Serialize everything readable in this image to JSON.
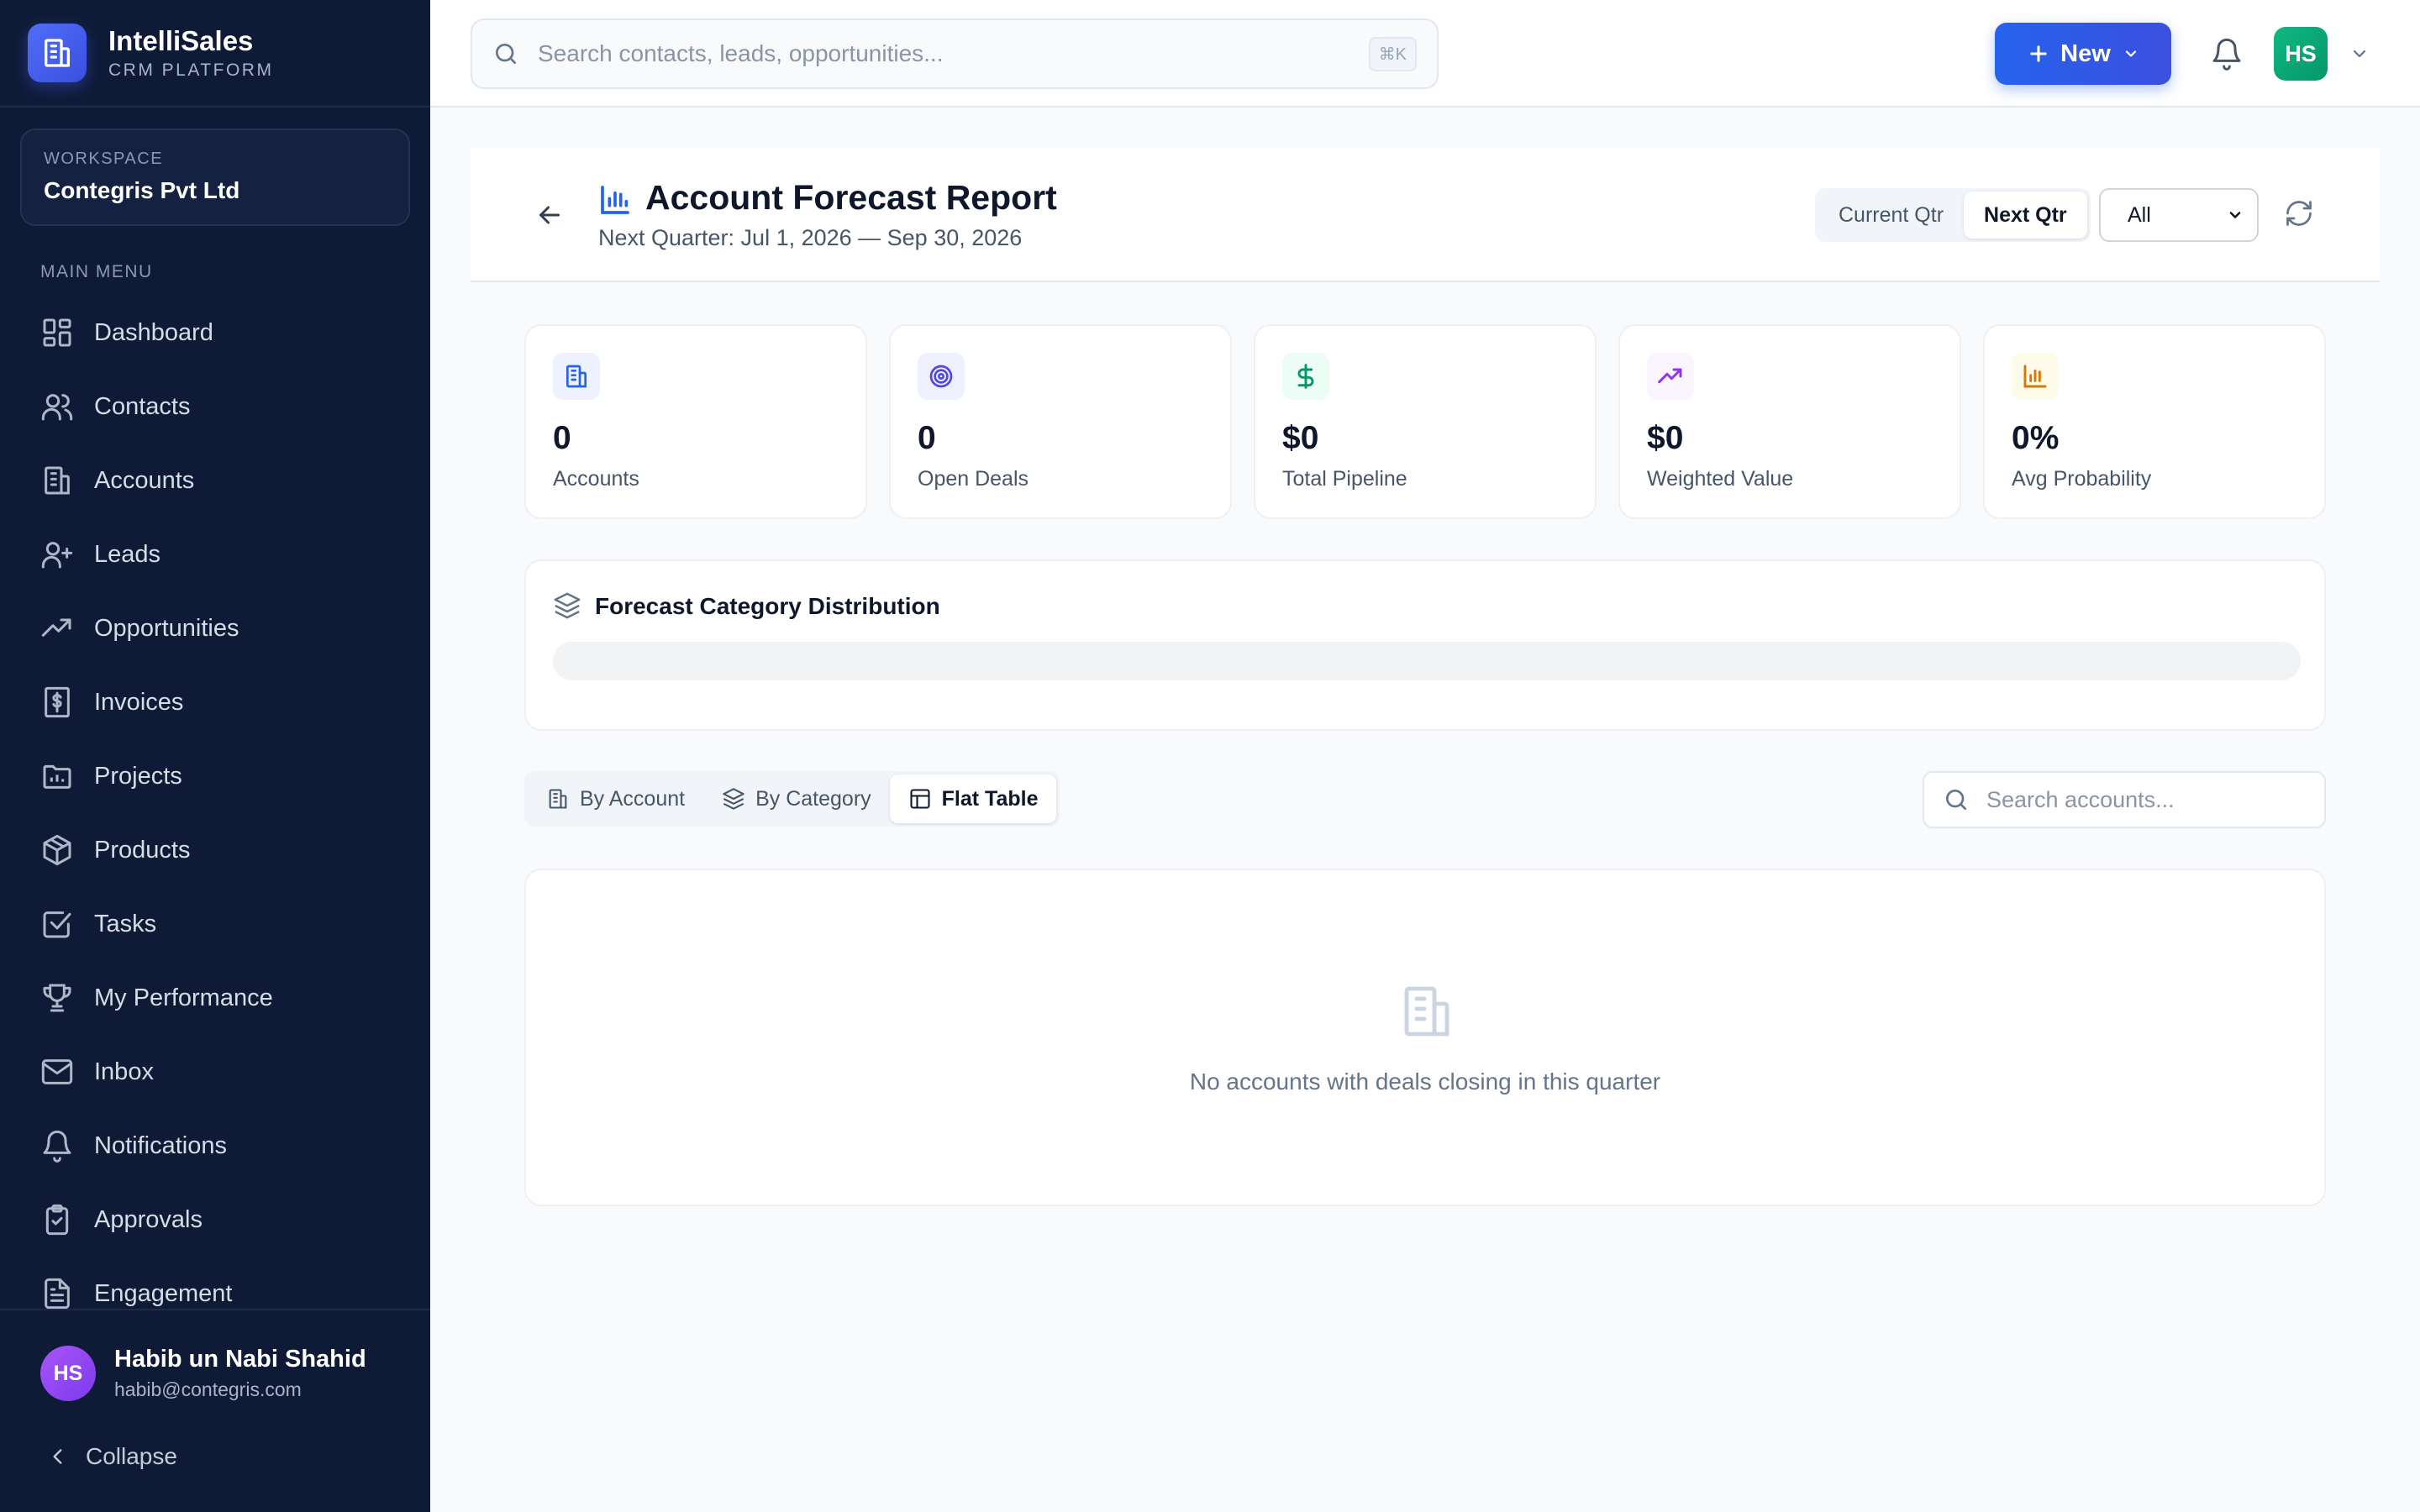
{
  "brand": {
    "name": "IntelliSales",
    "subtitle": "CRM PLATFORM"
  },
  "workspace": {
    "label": "WORKSPACE",
    "name": "Contegris Pvt Ltd"
  },
  "sidebar": {
    "menu_label": "MAIN MENU",
    "items": [
      {
        "label": "Dashboard",
        "icon": "dashboard-icon"
      },
      {
        "label": "Contacts",
        "icon": "users-icon"
      },
      {
        "label": "Accounts",
        "icon": "building-icon"
      },
      {
        "label": "Leads",
        "icon": "user-plus-icon"
      },
      {
        "label": "Opportunities",
        "icon": "trending-up-icon"
      },
      {
        "label": "Invoices",
        "icon": "invoice-icon"
      },
      {
        "label": "Projects",
        "icon": "folder-icon"
      },
      {
        "label": "Products",
        "icon": "box-icon"
      },
      {
        "label": "Tasks",
        "icon": "check-square-icon"
      },
      {
        "label": "My Performance",
        "icon": "trophy-icon"
      },
      {
        "label": "Inbox",
        "icon": "mail-icon"
      },
      {
        "label": "Notifications",
        "icon": "bell-icon"
      },
      {
        "label": "Approvals",
        "icon": "clipboard-check-icon"
      },
      {
        "label": "Engagement",
        "icon": "file-text-icon"
      }
    ],
    "user": {
      "initials": "HS",
      "name": "Habib un Nabi Shahid",
      "email": "habib@contegris.com"
    },
    "collapse_label": "Collapse"
  },
  "topbar": {
    "search_placeholder": "Search contacts, leads, opportunities...",
    "shortcut": "⌘K",
    "new_label": "New",
    "avatar_initials": "HS"
  },
  "report": {
    "title": "Account Forecast Report",
    "subtitle": "Next Quarter: Jul 1, 2026 — Sep 30, 2026",
    "period_tabs": [
      "Current Qtr",
      "Next Qtr"
    ],
    "active_period": "Next Qtr",
    "filter_value": "All"
  },
  "stats": [
    {
      "value": "0",
      "label": "Accounts",
      "icon": "building-icon",
      "color": "#2563eb",
      "bg": "#eef2ff"
    },
    {
      "value": "0",
      "label": "Open Deals",
      "icon": "target-icon",
      "color": "#4f46e5",
      "bg": "#eef0ff"
    },
    {
      "value": "$0",
      "label": "Total Pipeline",
      "icon": "dollar-icon",
      "color": "#059669",
      "bg": "#ecfdf5"
    },
    {
      "value": "$0",
      "label": "Weighted Value",
      "icon": "trending-up-icon",
      "color": "#9333ea",
      "bg": "#faf5ff"
    },
    {
      "value": "0%",
      "label": "Avg Probability",
      "icon": "bar-chart-icon",
      "color": "#d97706",
      "bg": "#fffbeb"
    }
  ],
  "distribution": {
    "title": "Forecast Category Distribution"
  },
  "view_tabs": [
    {
      "label": "By Account",
      "icon": "building-icon"
    },
    {
      "label": "By Category",
      "icon": "layers-icon"
    },
    {
      "label": "Flat Table",
      "icon": "table-icon"
    }
  ],
  "active_view": "Flat Table",
  "account_search_placeholder": "Search accounts...",
  "empty_state": {
    "message": "No accounts with deals closing in this quarter",
    "icon": "building-icon"
  },
  "colors": {
    "sidebar_bg": "#0f1b36",
    "accent": "#2563eb",
    "avatar_green": "#10b981",
    "avatar_purple": "#8b5cf6"
  }
}
